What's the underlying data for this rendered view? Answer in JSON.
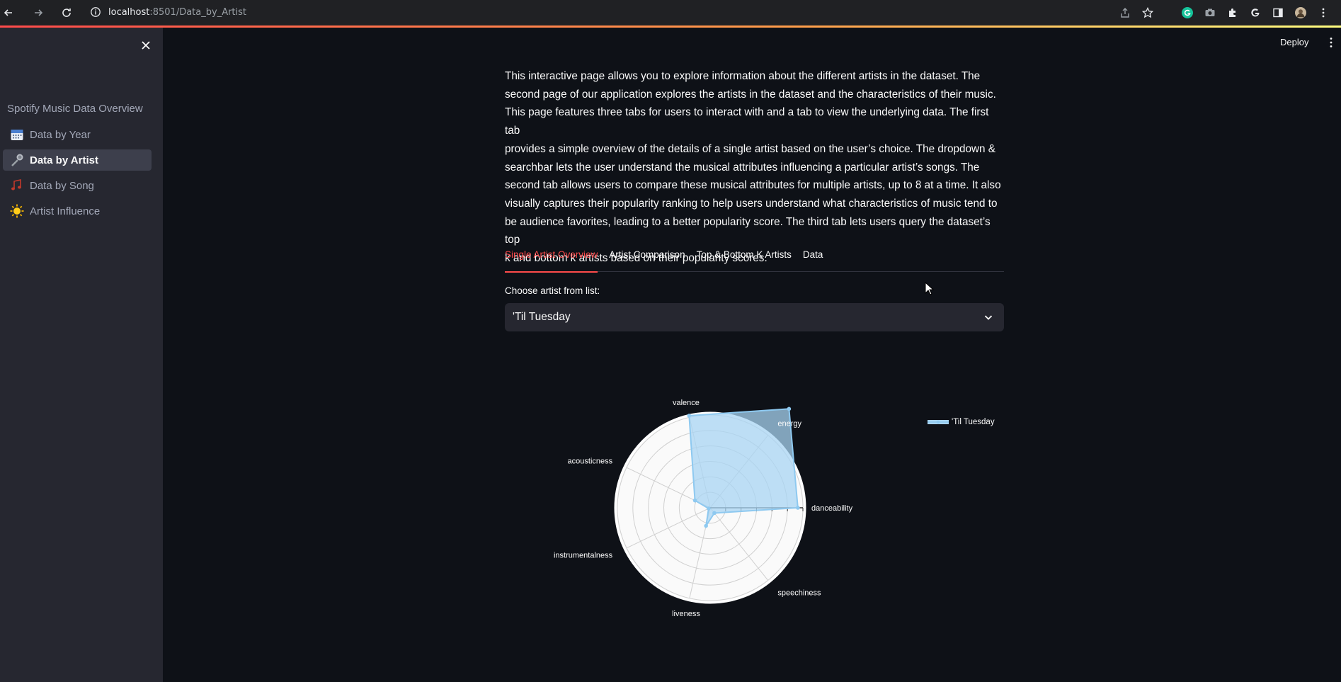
{
  "browser": {
    "url_host": "localhost",
    "url_path": ":8501/Data_by_Artist"
  },
  "sidebar": {
    "title": "Spotify Music Data Overview",
    "items": [
      {
        "label": "Data by Year",
        "icon": "calendar-icon"
      },
      {
        "label": "Data by Artist",
        "icon": "microphone-icon",
        "active": true
      },
      {
        "label": "Data by Song",
        "icon": "music-notes-icon"
      },
      {
        "label": "Artist Influence",
        "icon": "sun-icon"
      }
    ]
  },
  "header": {
    "deploy_label": "Deploy"
  },
  "main": {
    "intro_lines": [
      "This interactive page allows you to explore information about the different artists in the dataset. The",
      "second page of our application explores the artists in the dataset and the characteristics of their music.",
      "This page features three tabs for users to interact with and a tab to view the underlying data. The first tab",
      "provides a simple overview of the details of a single artist based on the user’s choice. The dropdown &",
      "searchbar lets the user understand the musical attributes influencing a particular artist’s songs. The",
      "second tab allows users to compare these musical attributes for multiple artists, up to 8 at a time. It also",
      "visually captures their popularity ranking to help users understand what characteristics of music tend to",
      "be audience favorites, leading to a better popularity score. The third tab lets users query the dataset’s top",
      "k and bottom k artists based on their popularity scores."
    ],
    "tabs": [
      {
        "label": "Single Artist Overview",
        "active": true
      },
      {
        "label": "Artist Comparison"
      },
      {
        "label": "Top & Bottom K Artists"
      },
      {
        "label": "Data"
      }
    ],
    "select_label": "Choose artist from list:",
    "select_value": "'Til Tuesday"
  },
  "chart_data": {
    "type": "radar",
    "axes": [
      "danceability",
      "energy",
      "valence",
      "acousticness",
      "instrumentalness",
      "liveness",
      "speechiness"
    ],
    "series": [
      {
        "name": "'Til Tuesday",
        "values": [
          0.52,
          0.75,
          0.56,
          0.1,
          0.01,
          0.11,
          0.04
        ]
      }
    ],
    "rlim": [
      0,
      0.55
    ],
    "colors": {
      "fill": "#a8d4f3",
      "line": "#8ec9f0",
      "background": "#fafafa",
      "grid": "#d0d0d0"
    }
  },
  "colors": {
    "accent": "#ff4b4b",
    "app_bg": "#0e1117",
    "sidebar_bg": "#262730"
  }
}
